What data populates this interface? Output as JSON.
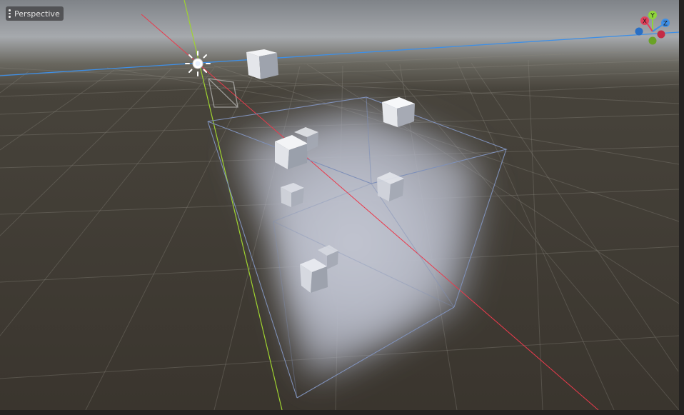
{
  "viewport": {
    "view_menu_label": "Perspective"
  },
  "axis_gizmo": {
    "x_label": "X",
    "y_label": "Y",
    "z_label": "Z",
    "x_color": "#e0405a",
    "y_color": "#8ed43a",
    "z_color": "#3e8fe6"
  },
  "scene": {
    "background_top": "#8a8e94",
    "floor_color": "#3f3a32",
    "volume_glow": "#eef0f6",
    "box_outline": "#7b8cb0",
    "light_icon": "omni-light-icon",
    "camera_icon": "directional-arrow-icon"
  }
}
